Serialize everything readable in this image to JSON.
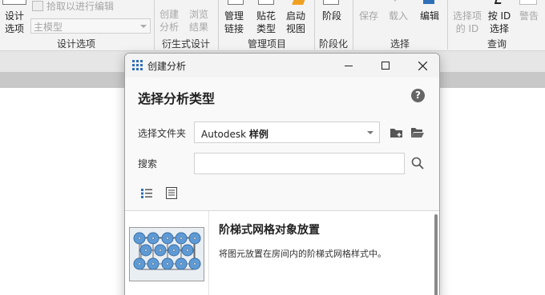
{
  "ribbon": {
    "design_options": {
      "btn_label_1": "设计",
      "btn_label_2": "选项",
      "pick_label": "拾取以进行编辑",
      "combo_value": "主模型",
      "group": "设计选项"
    },
    "generative": {
      "create_1": "创建",
      "create_2": "分析",
      "browse_1": "浏览",
      "browse_2": "结果",
      "group": "衍生式设计"
    },
    "manage_project": {
      "manage_1": "管理",
      "manage_2": "链接",
      "decal_1": "贴花",
      "decal_2": "类型",
      "startup_1": "启动",
      "startup_2": "视图",
      "group": "管理项目"
    },
    "phasing": {
      "phase": "阶段",
      "group": "阶段化"
    },
    "selection": {
      "save": "保存",
      "load": "载入",
      "edit": "编辑",
      "group": "选择"
    },
    "inquiry": {
      "select_id_1": "选择项",
      "select_id_2": "的 ID",
      "by_id_1": "按 ID",
      "by_id_2": "选择",
      "warnings": "警告",
      "group": "查询"
    }
  },
  "dialog": {
    "title": "创建分析",
    "heading": "选择分析类型",
    "help": "?",
    "folder_label": "选择文件夹",
    "folder_value_prefix": "Autodesk",
    "folder_value_bold": "样例",
    "search_label": "搜索",
    "search_value": "",
    "items": [
      {
        "title": "阶梯式网格对象放置",
        "description": "将图元放置在房间内的阶梯式网格样式中。"
      }
    ]
  },
  "colors": {
    "accent": "#2f6fb8",
    "thumb_circle": "#5e9bd6"
  }
}
